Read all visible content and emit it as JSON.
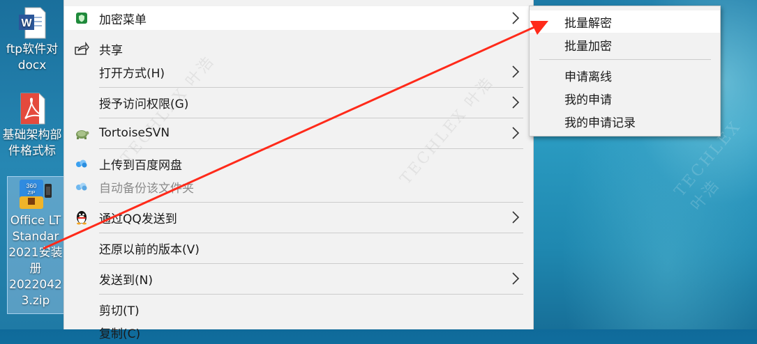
{
  "desktop": {
    "icons": [
      {
        "label_lines": [
          "ftp软件对",
          "docx"
        ],
        "type": "word-doc-icon"
      },
      {
        "label_lines": [
          "基础架构部",
          "件格式标"
        ],
        "type": "pdf-file-icon"
      },
      {
        "label_lines": [
          "Office LT",
          "Standar",
          "2021安装",
          "册",
          "2022042",
          "3.zip"
        ],
        "type": "zip-archive-icon"
      }
    ]
  },
  "context_menu": {
    "items": [
      {
        "label": "加密菜单",
        "icon": "green-shield-icon",
        "submenu": true
      },
      {
        "label": "共享",
        "icon": "share-icon",
        "submenu": false
      },
      {
        "label": "打开方式(H)",
        "icon": "",
        "submenu": true
      },
      {
        "label": "授予访问权限(G)",
        "icon": "",
        "submenu": true
      },
      {
        "label": "TortoiseSVN",
        "icon": "tortoise-icon",
        "submenu": true
      },
      {
        "label": "上传到百度网盘",
        "icon": "baidu-cloud-icon",
        "submenu": false
      },
      {
        "label": "自动备份该文件夹",
        "icon": "baidu-cloud-icon",
        "submenu": false,
        "disabled": true
      },
      {
        "label": "通过QQ发送到",
        "icon": "qq-penguin-icon",
        "submenu": true
      },
      {
        "label": "还原以前的版本(V)",
        "icon": "",
        "submenu": false
      },
      {
        "label": "发送到(N)",
        "icon": "",
        "submenu": true
      },
      {
        "label": "剪切(T)",
        "icon": "",
        "submenu": false
      },
      {
        "label": "复制(C)",
        "icon": "",
        "submenu": false
      }
    ]
  },
  "submenu": {
    "items": [
      "批量解密",
      "批量加密",
      "申请离线",
      "我的申请",
      "我的申请记录"
    ]
  },
  "watermark": {
    "text": "TECHLEX 叶浩"
  },
  "colors": {
    "menu_bg": "#f2f2f2",
    "highlight": "#ffffff",
    "arrow": "#ff2a1a"
  }
}
